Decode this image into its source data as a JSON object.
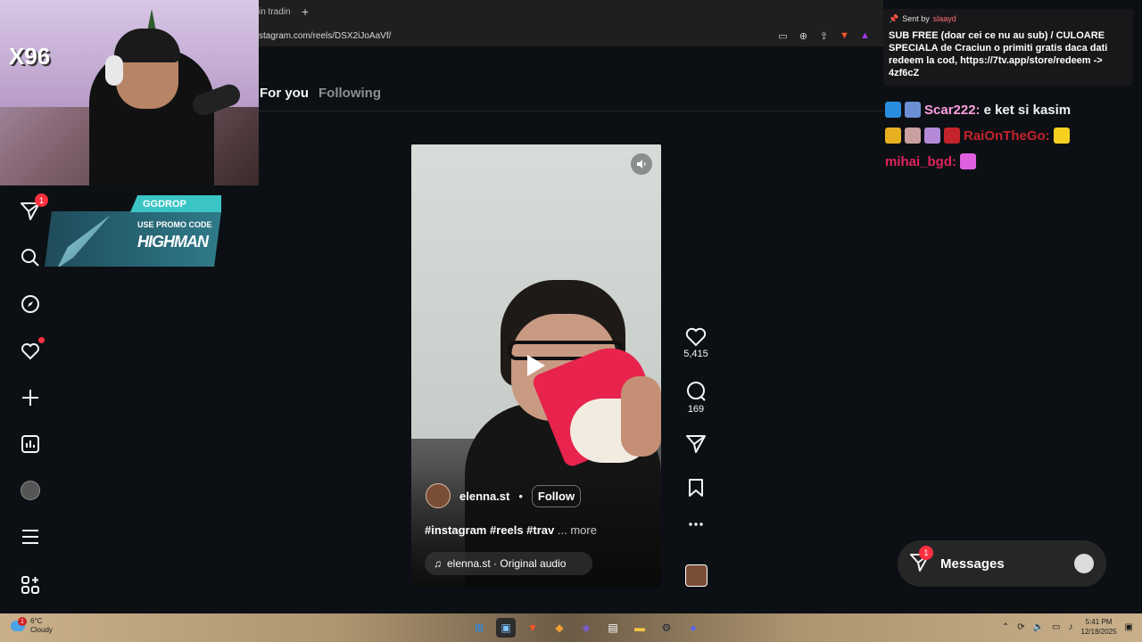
{
  "browser": {
    "tab_title": "in trading",
    "new_tab": "+",
    "url": "stagram.com/reels/DSX2iJoAaVf/"
  },
  "instagram": {
    "feed_tabs": [
      "For you",
      "Following"
    ],
    "reel": {
      "author": "elenna.st",
      "dot": "•",
      "follow_label": "Follow",
      "caption": "#instagram #reels #trav",
      "caption_more": "... more",
      "audio": "elenna.st · Original audio",
      "likes": "5,415",
      "comments": "169"
    },
    "nav": {
      "notification_badge": "1"
    }
  },
  "webcam": {
    "badge": "X96"
  },
  "promo": {
    "tag": "GGDROP",
    "label": "USE PROMO CODE",
    "code": "HIGHMAN"
  },
  "chat": {
    "pinned_prefix": "Sent by",
    "pinned_sender": "slaayd",
    "pinned_message": "SUB FREE (doar cei ce nu au sub) / CULOARE SPECIALA de Craciun o primiti gratis daca dati redeem la cod, https://7tv.app/store/redeem -> 4zf6cZ",
    "lines": [
      {
        "user": "Scar222:",
        "text": "e ket si kasim",
        "color": "#ff9fe0"
      },
      {
        "user": "RaiOnTheGo:",
        "text": "",
        "color": "#c4232b"
      },
      {
        "user": "mihai_bgd:",
        "text": "",
        "color": "#e0245e"
      }
    ]
  },
  "messages": {
    "label": "Messages",
    "badge": "1"
  },
  "taskbar": {
    "weather_badge": "1",
    "temp": "6°C",
    "condition": "Cloudy",
    "time": "5:41 PM",
    "date": "12/18/2025"
  }
}
